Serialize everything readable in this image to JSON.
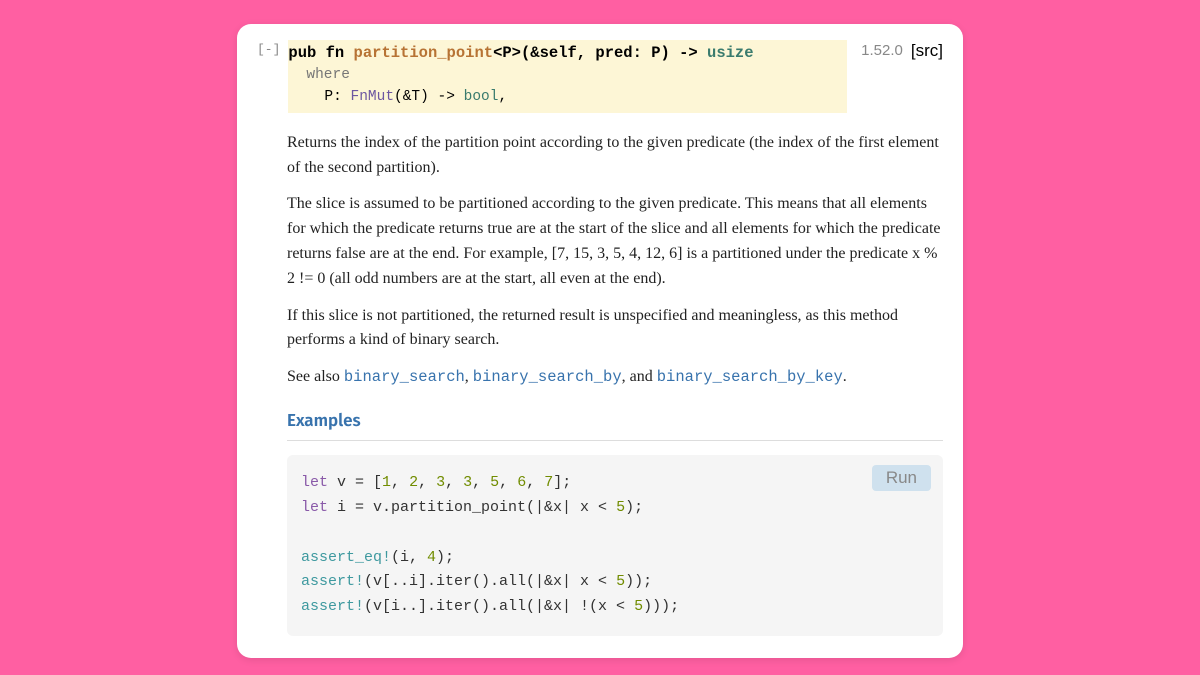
{
  "collapse_label": "[-]",
  "signature": {
    "kw_pub": "pub",
    "kw_fn": "fn",
    "name": "partition_point",
    "generic_open": "<P>",
    "params": "(&self, pred: P) -> ",
    "ret_type": "usize",
    "where_kw": "where",
    "where_param": "P: ",
    "where_trait": "FnMut",
    "where_sig_open": "(&T) -> ",
    "where_bool": "bool",
    "where_comma": ","
  },
  "since_version": "1.52.0",
  "src_label": "[src]",
  "paragraphs": {
    "p1": "Returns the index of the partition point according to the given predicate (the index of the first element of the second partition).",
    "p2": "The slice is assumed to be partitioned according to the given predicate. This means that all elements for which the predicate returns true are at the start of the slice and all elements for which the predicate returns false are at the end. For example, [7, 15, 3, 5, 4, 12, 6] is a partitioned under the predicate x % 2 != 0 (all odd numbers are at the start, all even at the end).",
    "p3": "If this slice is not partitioned, the returned result is unspecified and meaningless, as this method performs a kind of binary search.",
    "see_also_prefix": "See also ",
    "link_bs": "binary_search",
    "link_bsb": "binary_search_by",
    "link_bsbk": "binary_search_by_key",
    "sep_comma": ", ",
    "sep_and": ", and ",
    "period": "."
  },
  "examples_header": "Examples",
  "run_label": "Run",
  "code": {
    "let": "let",
    "l1_a": " v = [",
    "n1": "1",
    "n2": "2",
    "n3": "3",
    "n4": "3",
    "n5": "5",
    "n6": "6",
    "n7": "7",
    "cs": ", ",
    "l1_b": "];",
    "l2_a": " i = v.partition_point(|&x| x < ",
    "fivenum": "5",
    "l2_b": ");",
    "assert_eq": "assert_eq!",
    "l3_a": "(i, ",
    "four": "4",
    "l3_b": ");",
    "assert": "assert!",
    "l4_a": "(v[..i].iter().all(|&x| x < ",
    "l4_b": "));",
    "l5_a": "(v[i..].iter().all(|&x| !(x < ",
    "l5_b": ")));"
  }
}
